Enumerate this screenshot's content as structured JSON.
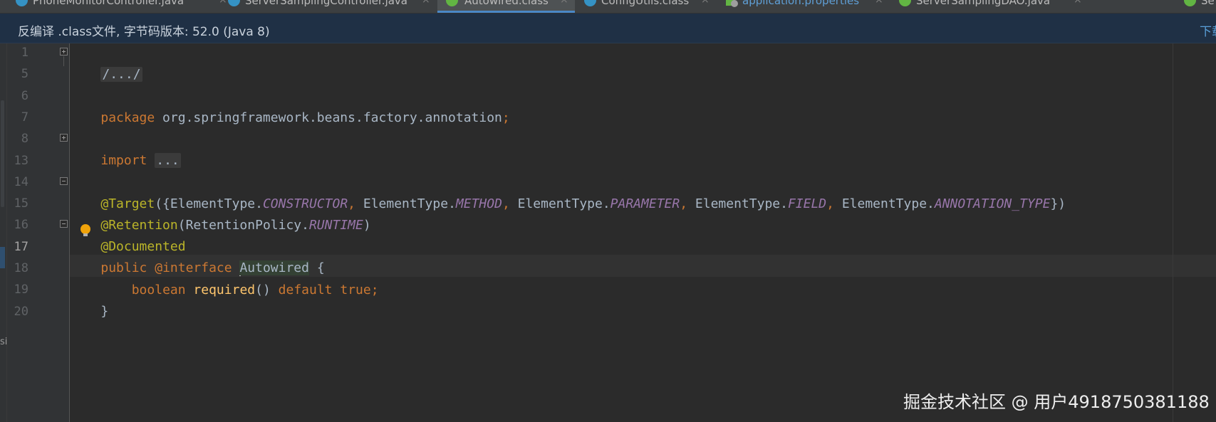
{
  "tabs": [
    {
      "label": "PhoneMonitorController.java",
      "icon": "class-icon",
      "active": false
    },
    {
      "label": "ServerSamplingController.java",
      "icon": "class-icon",
      "active": false
    },
    {
      "label": "Autowired.class",
      "icon": "annotation-icon",
      "active": true
    },
    {
      "label": "ConfigUtils.class",
      "icon": "class-icon",
      "active": false
    },
    {
      "label": "application.properties",
      "icon": "properties-icon",
      "active": false
    },
    {
      "label": "ServerSamplingDAO.java",
      "icon": "interface-icon",
      "active": false
    },
    {
      "label": "Se",
      "icon": "interface-icon",
      "active": false
    }
  ],
  "tab_close_glyph": "×",
  "banner": {
    "text": "反编译 .class文件, 字节码版本: 52.0 (Java 8)",
    "link": "下载"
  },
  "side_text": "si",
  "gutter": {
    "line_numbers": [
      "1",
      "5",
      "6",
      "7",
      "8",
      "13",
      "14",
      "15",
      "16",
      "17",
      "18",
      "19",
      "20"
    ],
    "current_line": "17"
  },
  "code": {
    "line1": "/.../",
    "line6_kw": "package",
    "line6_name": " org.springframework.beans.factory.annotation",
    "line6_semi": ";",
    "line8_kw": "import",
    "line8_fold": "...",
    "line14": {
      "anno": "@Target",
      "open": "({",
      "et": "ElementType.",
      "c1": "CONSTRUCTOR",
      "c2": "METHOD",
      "c3": "PARAMETER",
      "c4": "FIELD",
      "c5": "ANNOTATION_TYPE",
      "comma": ",",
      "close": "})"
    },
    "line15": {
      "anno": "@Retention",
      "open": "(RetentionPolicy.",
      "c": "RUNTIME",
      "close": ")"
    },
    "line16": "@Documented",
    "line17": {
      "kw1": "public",
      "kw2": "@interface",
      "name": "Autowired",
      "brace": "{"
    },
    "line18": {
      "type": "boolean",
      "method": "required",
      "parens": "()",
      "kw": "default",
      "val": "true",
      "semi": ";"
    },
    "line19": "}"
  },
  "watermark": "掘金技术社区 @ 用户4918750381188",
  "colors": {
    "background": "#2b2b2b",
    "keyword": "#cc7832",
    "annotation": "#bbb529",
    "constant": "#9876aa",
    "method": "#ffc66d",
    "text": "#a9b7c6",
    "banner": "#1f3045"
  }
}
